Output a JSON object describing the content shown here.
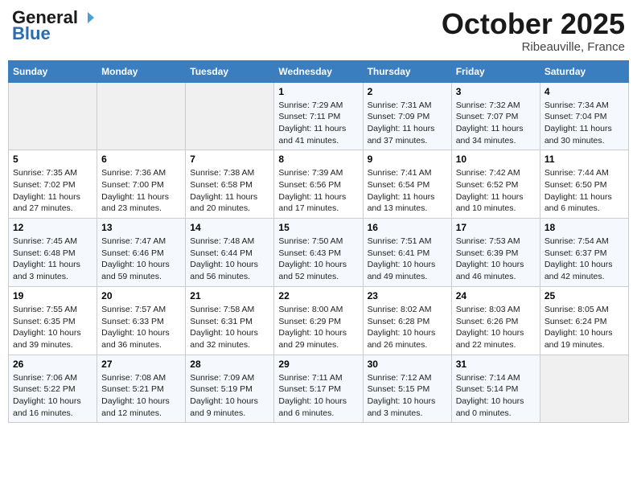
{
  "header": {
    "logo_general": "General",
    "logo_blue": "Blue",
    "month": "October 2025",
    "location": "Ribeauville, France"
  },
  "days_of_week": [
    "Sunday",
    "Monday",
    "Tuesday",
    "Wednesday",
    "Thursday",
    "Friday",
    "Saturday"
  ],
  "weeks": [
    [
      {
        "day": "",
        "content": ""
      },
      {
        "day": "",
        "content": ""
      },
      {
        "day": "",
        "content": ""
      },
      {
        "day": "1",
        "content": "Sunrise: 7:29 AM\nSunset: 7:11 PM\nDaylight: 11 hours and 41 minutes."
      },
      {
        "day": "2",
        "content": "Sunrise: 7:31 AM\nSunset: 7:09 PM\nDaylight: 11 hours and 37 minutes."
      },
      {
        "day": "3",
        "content": "Sunrise: 7:32 AM\nSunset: 7:07 PM\nDaylight: 11 hours and 34 minutes."
      },
      {
        "day": "4",
        "content": "Sunrise: 7:34 AM\nSunset: 7:04 PM\nDaylight: 11 hours and 30 minutes."
      }
    ],
    [
      {
        "day": "5",
        "content": "Sunrise: 7:35 AM\nSunset: 7:02 PM\nDaylight: 11 hours and 27 minutes."
      },
      {
        "day": "6",
        "content": "Sunrise: 7:36 AM\nSunset: 7:00 PM\nDaylight: 11 hours and 23 minutes."
      },
      {
        "day": "7",
        "content": "Sunrise: 7:38 AM\nSunset: 6:58 PM\nDaylight: 11 hours and 20 minutes."
      },
      {
        "day": "8",
        "content": "Sunrise: 7:39 AM\nSunset: 6:56 PM\nDaylight: 11 hours and 17 minutes."
      },
      {
        "day": "9",
        "content": "Sunrise: 7:41 AM\nSunset: 6:54 PM\nDaylight: 11 hours and 13 minutes."
      },
      {
        "day": "10",
        "content": "Sunrise: 7:42 AM\nSunset: 6:52 PM\nDaylight: 11 hours and 10 minutes."
      },
      {
        "day": "11",
        "content": "Sunrise: 7:44 AM\nSunset: 6:50 PM\nDaylight: 11 hours and 6 minutes."
      }
    ],
    [
      {
        "day": "12",
        "content": "Sunrise: 7:45 AM\nSunset: 6:48 PM\nDaylight: 11 hours and 3 minutes."
      },
      {
        "day": "13",
        "content": "Sunrise: 7:47 AM\nSunset: 6:46 PM\nDaylight: 10 hours and 59 minutes."
      },
      {
        "day": "14",
        "content": "Sunrise: 7:48 AM\nSunset: 6:44 PM\nDaylight: 10 hours and 56 minutes."
      },
      {
        "day": "15",
        "content": "Sunrise: 7:50 AM\nSunset: 6:43 PM\nDaylight: 10 hours and 52 minutes."
      },
      {
        "day": "16",
        "content": "Sunrise: 7:51 AM\nSunset: 6:41 PM\nDaylight: 10 hours and 49 minutes."
      },
      {
        "day": "17",
        "content": "Sunrise: 7:53 AM\nSunset: 6:39 PM\nDaylight: 10 hours and 46 minutes."
      },
      {
        "day": "18",
        "content": "Sunrise: 7:54 AM\nSunset: 6:37 PM\nDaylight: 10 hours and 42 minutes."
      }
    ],
    [
      {
        "day": "19",
        "content": "Sunrise: 7:55 AM\nSunset: 6:35 PM\nDaylight: 10 hours and 39 minutes."
      },
      {
        "day": "20",
        "content": "Sunrise: 7:57 AM\nSunset: 6:33 PM\nDaylight: 10 hours and 36 minutes."
      },
      {
        "day": "21",
        "content": "Sunrise: 7:58 AM\nSunset: 6:31 PM\nDaylight: 10 hours and 32 minutes."
      },
      {
        "day": "22",
        "content": "Sunrise: 8:00 AM\nSunset: 6:29 PM\nDaylight: 10 hours and 29 minutes."
      },
      {
        "day": "23",
        "content": "Sunrise: 8:02 AM\nSunset: 6:28 PM\nDaylight: 10 hours and 26 minutes."
      },
      {
        "day": "24",
        "content": "Sunrise: 8:03 AM\nSunset: 6:26 PM\nDaylight: 10 hours and 22 minutes."
      },
      {
        "day": "25",
        "content": "Sunrise: 8:05 AM\nSunset: 6:24 PM\nDaylight: 10 hours and 19 minutes."
      }
    ],
    [
      {
        "day": "26",
        "content": "Sunrise: 7:06 AM\nSunset: 5:22 PM\nDaylight: 10 hours and 16 minutes."
      },
      {
        "day": "27",
        "content": "Sunrise: 7:08 AM\nSunset: 5:21 PM\nDaylight: 10 hours and 12 minutes."
      },
      {
        "day": "28",
        "content": "Sunrise: 7:09 AM\nSunset: 5:19 PM\nDaylight: 10 hours and 9 minutes."
      },
      {
        "day": "29",
        "content": "Sunrise: 7:11 AM\nSunset: 5:17 PM\nDaylight: 10 hours and 6 minutes."
      },
      {
        "day": "30",
        "content": "Sunrise: 7:12 AM\nSunset: 5:15 PM\nDaylight: 10 hours and 3 minutes."
      },
      {
        "day": "31",
        "content": "Sunrise: 7:14 AM\nSunset: 5:14 PM\nDaylight: 10 hours and 0 minutes."
      },
      {
        "day": "",
        "content": ""
      }
    ]
  ]
}
